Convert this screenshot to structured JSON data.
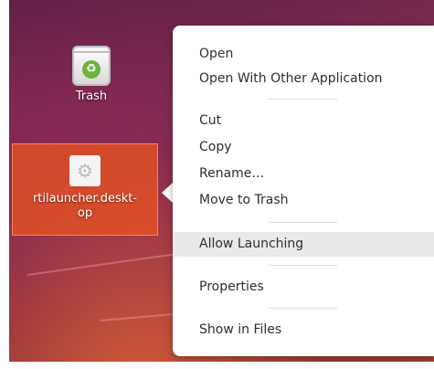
{
  "desktop": {
    "icons": [
      {
        "label": "Trash",
        "icon": "trash-recycle-icon"
      },
      {
        "label": "rtilauncher.deskt-\nop",
        "label_line1": "rtilauncher.deskt-",
        "label_line2": "op",
        "icon": "gear-icon",
        "selected": true
      }
    ]
  },
  "context_menu": {
    "items": [
      {
        "label": "Open"
      },
      {
        "label": "Open With Other Application"
      },
      {
        "label": "Cut"
      },
      {
        "label": "Copy"
      },
      {
        "label": "Rename…"
      },
      {
        "label": "Move to Trash"
      },
      {
        "label": "Allow Launching",
        "highlighted": true
      },
      {
        "label": "Properties"
      },
      {
        "label": "Show in Files"
      }
    ]
  },
  "colors": {
    "selection": "#e95420",
    "menu_background": "#ffffff",
    "menu_hover": "#e9e9e9",
    "menu_text": "#2e2e2e"
  }
}
